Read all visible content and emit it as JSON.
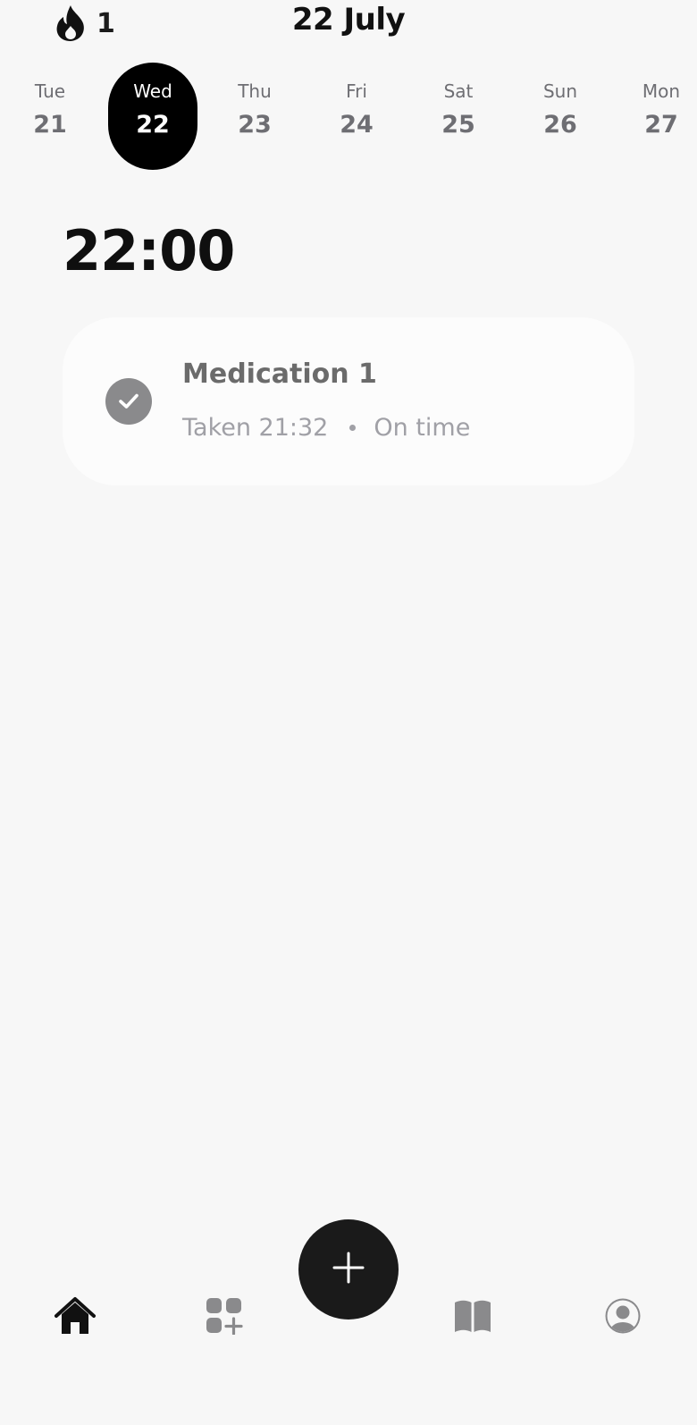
{
  "header": {
    "streak_count": "1",
    "date_title": "22 July"
  },
  "week": {
    "days": [
      {
        "name": "Tue",
        "num": "21"
      },
      {
        "name": "Wed",
        "num": "22"
      },
      {
        "name": "Thu",
        "num": "23"
      },
      {
        "name": "Fri",
        "num": "24"
      },
      {
        "name": "Sat",
        "num": "25"
      },
      {
        "name": "Sun",
        "num": "26"
      },
      {
        "name": "Mon",
        "num": "27"
      }
    ],
    "selected_index": 1
  },
  "schedule": {
    "time": "22:00",
    "entries": [
      {
        "name": "Medication 1",
        "taken_text": "Taken 21:32",
        "timing": "On time"
      }
    ]
  },
  "nav": {
    "items": [
      {
        "icon": "home-icon"
      },
      {
        "icon": "add-apps-icon"
      },
      {
        "icon": "plus-icon"
      },
      {
        "icon": "book-icon"
      },
      {
        "icon": "profile-icon"
      }
    ]
  },
  "colors": {
    "background": "#f7f7f7",
    "selected_day": "#000000",
    "check_circle": "#8a8a8c",
    "muted_text": "#a0a0a6",
    "fab": "#1a1a1a"
  }
}
